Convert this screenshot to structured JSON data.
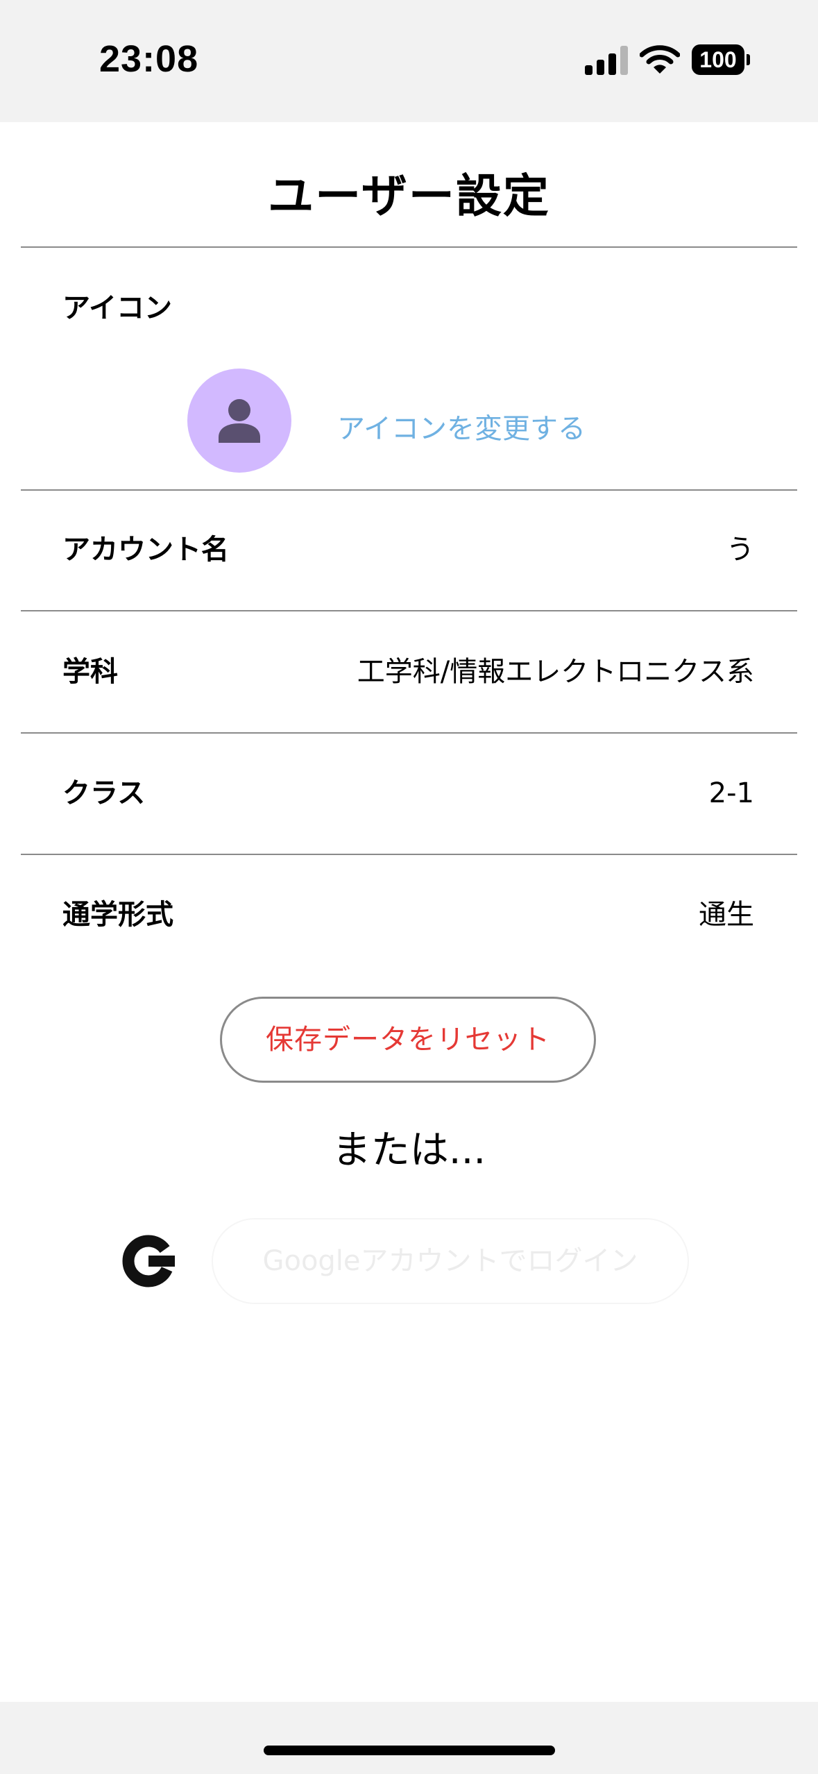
{
  "status_bar": {
    "time": "23:08",
    "battery": "100",
    "icons": [
      "cellular-signal-icon",
      "wifi-icon",
      "battery-icon"
    ]
  },
  "header": {
    "title": "ユーザー設定"
  },
  "settings": {
    "icon_label": "アイコン",
    "change_icon_label": "アイコンを変更する",
    "account_name_label": "アカウント名",
    "account_name_value": "う",
    "department_label": "学科",
    "department_value": "工学科/情報エレクトロニクス系",
    "class_label": "クラス",
    "class_value": "2-1",
    "commute_label": "通学形式",
    "commute_value": "通生"
  },
  "actions": {
    "reset_label": "保存データをリセット",
    "or_text": "または...",
    "google_login_label": "Googleアカウントでログイン"
  },
  "colors": {
    "avatar_bg": "#d2b9ff",
    "avatar_figure": "#5a5070",
    "link": "#6fb1e2",
    "danger": "#e53935",
    "divider": "#8a8a8a",
    "system_bar": "#f2f2f2"
  }
}
